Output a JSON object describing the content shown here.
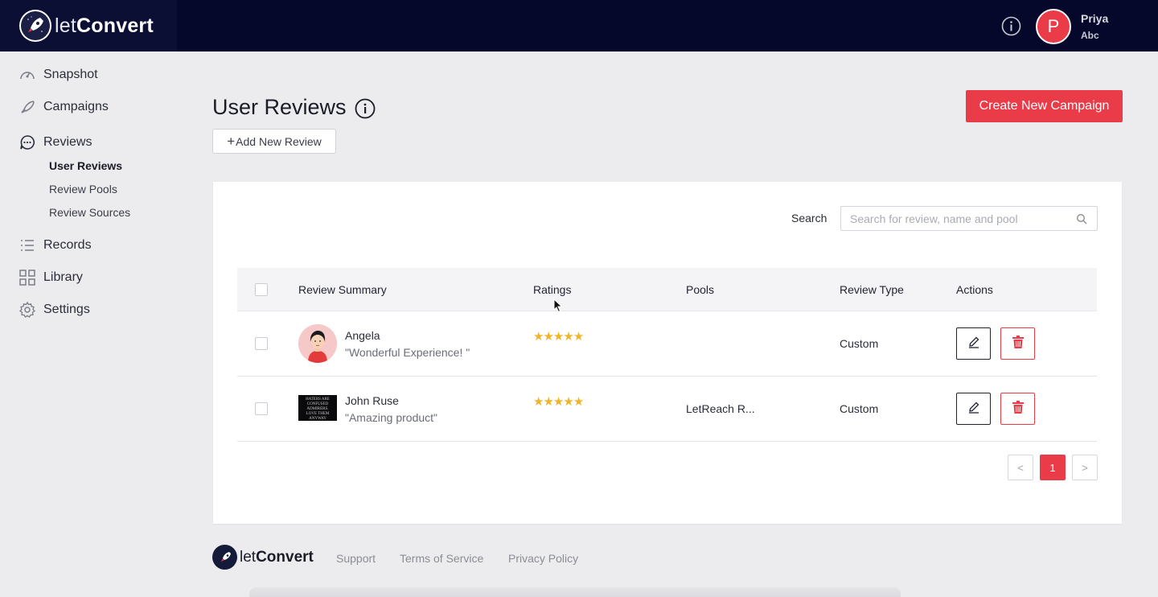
{
  "brand": {
    "logo_light": "let",
    "logo_bold": "Convert"
  },
  "user": {
    "initial": "P",
    "name": "Priya",
    "org": "Abc"
  },
  "sidebar": {
    "items": [
      {
        "label": "Snapshot",
        "icon": "speedometer-icon"
      },
      {
        "label": "Campaigns",
        "icon": "rocket-icon"
      },
      {
        "label": "Reviews",
        "icon": "chat-bubble-icon"
      },
      {
        "label": "Records",
        "icon": "list-icon"
      },
      {
        "label": "Library",
        "icon": "grid-icon"
      },
      {
        "label": "Settings",
        "icon": "gear-icon"
      }
    ],
    "reviews_sub": [
      {
        "label": "User Reviews",
        "active": true
      },
      {
        "label": "Review Pools",
        "active": false
      },
      {
        "label": "Review Sources",
        "active": false
      }
    ]
  },
  "page": {
    "title": "User Reviews",
    "add_button": "Add New Review",
    "create_button": "Create New Campaign"
  },
  "search": {
    "label": "Search",
    "placeholder": "Search for review, name and pool",
    "value": ""
  },
  "table": {
    "headers": [
      "Review Summary",
      "Ratings",
      "Pools",
      "Review Type",
      "Actions"
    ],
    "rows": [
      {
        "name": "Angela",
        "quote": "\"Wonderful Experience! \"",
        "rating": 5,
        "pool": "",
        "type": "Custom"
      },
      {
        "name": "John Ruse",
        "quote": "\"Amazing product\"",
        "rating": 5,
        "pool": "LetReach R...",
        "type": "Custom"
      }
    ]
  },
  "thumb_text": "HATERS ARE CONFUSED ADMIRERS. LOVE THEM ANYWAY",
  "pagination": {
    "prev": "<",
    "current": "1",
    "next": ">"
  },
  "footer": {
    "links": [
      "Support",
      "Terms of Service",
      "Privacy Policy"
    ]
  },
  "colors": {
    "accent": "#ea3b48",
    "topbar": "#05082a",
    "star": "#f0b429"
  }
}
